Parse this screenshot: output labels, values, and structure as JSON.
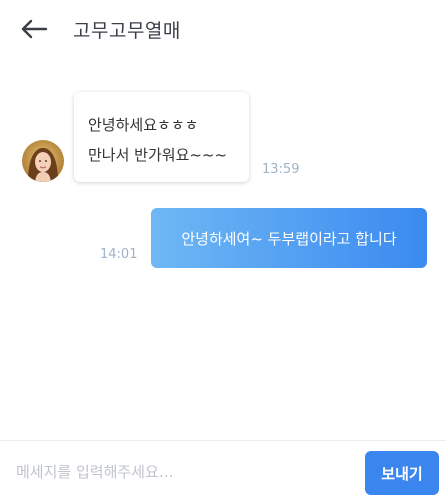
{
  "header": {
    "back_icon": "arrow-left-icon",
    "title": "고무고무열매"
  },
  "messages": [
    {
      "direction": "incoming",
      "avatar_icon": "profile-photo",
      "lines": [
        "안녕하세요ㅎㅎㅎ",
        "만나서 반가워요~~~"
      ],
      "time": "13:59"
    },
    {
      "direction": "outgoing",
      "text": "안녕하세여~ 두부랩이라고 합니다",
      "time": "14:01"
    }
  ],
  "composer": {
    "placeholder": "메세지를 입력해주세요…",
    "send_label": "보내기"
  },
  "colors": {
    "accent": "#3a86ee",
    "bubble_gradient_start": "#6fb7f4",
    "bubble_gradient_end": "#3a8af0",
    "timestamp": "#9fb3c8",
    "title": "#3a3f47"
  }
}
